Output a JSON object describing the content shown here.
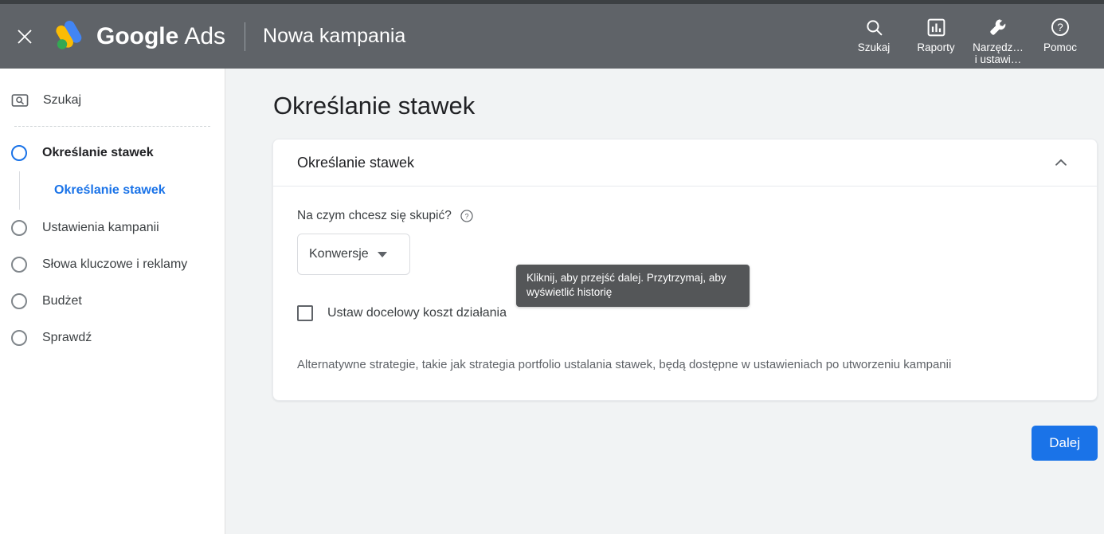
{
  "header": {
    "close_icon": "close-icon",
    "brand_google": "Google",
    "brand_ads": "Ads",
    "page_title": "Nowa kampania",
    "actions": [
      {
        "icon": "search-icon",
        "label": "Szukaj"
      },
      {
        "icon": "reports-bar-chart-icon",
        "label": "Raporty"
      },
      {
        "icon": "wrench-tools-icon",
        "label": "Narzędz…\ni ustawi…"
      },
      {
        "icon": "help-question-icon",
        "label": "Pomoc"
      }
    ],
    "bg_color": "#5f6368"
  },
  "sidebar": {
    "search": {
      "icon": "search-box-icon",
      "label": "Szukaj"
    },
    "steps": [
      {
        "label": "Określanie stawek",
        "active": true
      },
      {
        "label": "Ustawienia kampanii",
        "active": false
      },
      {
        "label": "Słowa kluczowe i reklamy",
        "active": false
      },
      {
        "label": "Budżet",
        "active": false
      },
      {
        "label": "Sprawdź",
        "active": false
      }
    ],
    "substep": "Określanie stawek",
    "accent_color": "#1a73e8"
  },
  "main": {
    "page_title": "Określanie stawek",
    "card": {
      "title": "Określanie stawek",
      "collapse_icon": "chevron-up-icon",
      "field_label": "Na czym chcesz się skupić?",
      "help_icon": "help-circle-icon",
      "select_value": "Konwersje",
      "checkbox_label": "Ustaw docelowy koszt działania",
      "note": "Alternatywne strategie, takie jak strategia portfolio ustalania stawek, będą dostępne w ustawieniach po utworzeniu kampanii"
    },
    "tooltip": "Kliknij, aby przejść dalej. Przytrzymaj, aby wyświetlić historię",
    "next_button": "Dalej",
    "next_button_color": "#1a73e8",
    "background_color": "#f1f3f4"
  }
}
